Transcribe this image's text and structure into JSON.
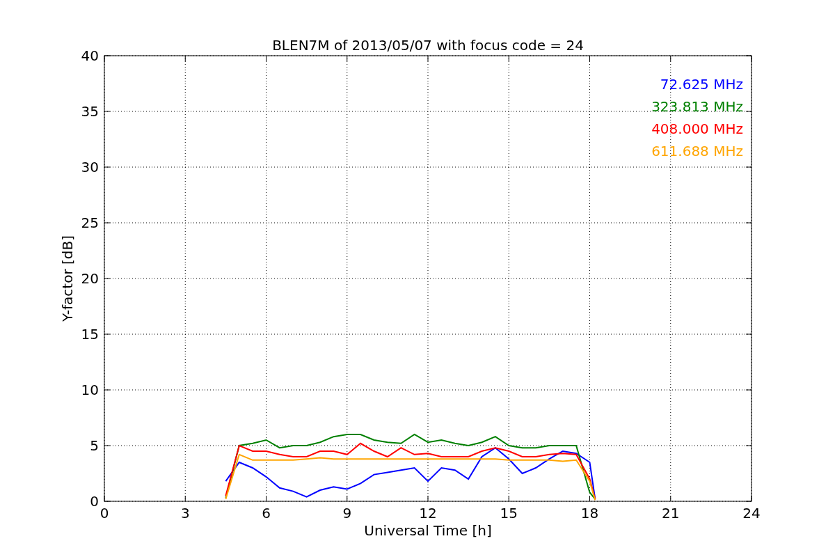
{
  "figure": {
    "chart_data": {
      "type": "line",
      "title": "BLEN7M of 2013/05/07 with focus code = 24",
      "xlabel": "Universal Time [h]",
      "ylabel": "Y-factor [dB]",
      "x": [
        4.5,
        5,
        5.5,
        6,
        6.5,
        7,
        7.5,
        8,
        8.5,
        9,
        9.5,
        10,
        10.5,
        11,
        11.5,
        12,
        12.5,
        13,
        13.5,
        14,
        14.5,
        15,
        15.5,
        16,
        16.5,
        17,
        17.5,
        18,
        18.2
      ],
      "series": [
        {
          "name": "72.625 MHz",
          "color": "#0000ff",
          "values": [
            1.8,
            3.5,
            3.0,
            2.2,
            1.2,
            0.9,
            0.4,
            1.0,
            1.3,
            1.1,
            1.6,
            2.4,
            2.6,
            2.8,
            3.0,
            1.8,
            3.0,
            2.8,
            2.0,
            4.0,
            4.8,
            3.8,
            2.5,
            3.0,
            3.8,
            4.5,
            4.3,
            3.5,
            0.2
          ]
        },
        {
          "name": "323.813 MHz",
          "color": "#008000",
          "values": [
            0.3,
            5.0,
            5.2,
            5.5,
            4.8,
            5.0,
            5.0,
            5.3,
            5.8,
            6.0,
            6.0,
            5.5,
            5.3,
            5.2,
            6.0,
            5.3,
            5.5,
            5.2,
            5.0,
            5.3,
            5.8,
            5.0,
            4.8,
            4.8,
            5.0,
            5.0,
            5.0,
            0.8,
            0.2
          ]
        },
        {
          "name": "408.000 MHz",
          "color": "#ff0000",
          "values": [
            0.5,
            5.0,
            4.5,
            4.5,
            4.2,
            4.0,
            4.0,
            4.5,
            4.5,
            4.2,
            5.2,
            4.5,
            4.0,
            4.8,
            4.2,
            4.3,
            4.0,
            4.0,
            4.0,
            4.5,
            4.8,
            4.5,
            4.0,
            4.0,
            4.2,
            4.3,
            4.2,
            2.0,
            0.2
          ]
        },
        {
          "name": "611.688 MHz",
          "color": "#ffa500",
          "values": [
            0.2,
            4.2,
            3.7,
            3.7,
            3.7,
            3.7,
            3.8,
            3.9,
            3.8,
            3.8,
            3.8,
            3.8,
            3.8,
            3.8,
            3.8,
            3.8,
            3.8,
            3.8,
            3.8,
            3.8,
            3.8,
            3.7,
            3.7,
            3.7,
            3.7,
            3.6,
            3.7,
            1.8,
            0.1
          ]
        }
      ],
      "xlim": [
        0,
        24
      ],
      "ylim": [
        0,
        40
      ],
      "grid": true,
      "xticks": [
        0,
        3,
        6,
        9,
        12,
        15,
        18,
        21,
        24
      ],
      "yticks": [
        0,
        5,
        10,
        15,
        20,
        25,
        30,
        35,
        40
      ]
    }
  }
}
